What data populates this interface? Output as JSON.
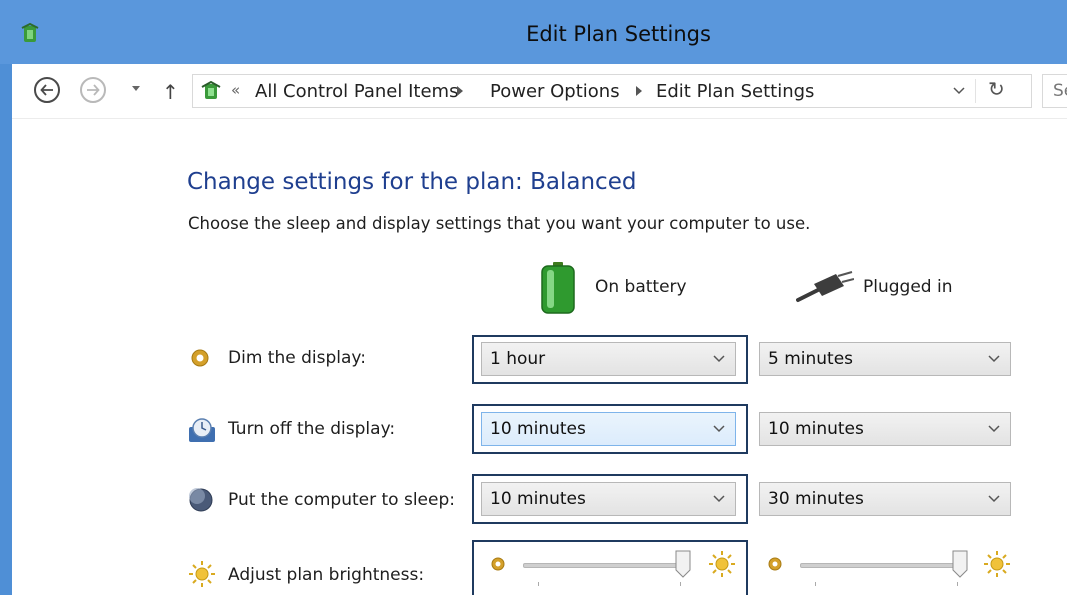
{
  "window": {
    "title": "Edit Plan Settings"
  },
  "address_bar": {
    "overflow": "«",
    "crumbs": [
      "All Control Panel Items",
      "Power Options",
      "Edit Plan Settings"
    ],
    "search_placeholder": "Se"
  },
  "page": {
    "heading": "Change settings for the plan: Balanced",
    "description": "Choose the sleep and display settings that you want your computer to use."
  },
  "columns": {
    "battery": "On battery",
    "plugged": "Plugged in"
  },
  "settings": {
    "dim": {
      "label": "Dim the display:",
      "battery": "1 hour",
      "plugged": "5 minutes",
      "icon": "dim-display-icon"
    },
    "display_off": {
      "label": "Turn off the display:",
      "battery": "10 minutes",
      "plugged": "10 minutes",
      "icon": "display-clock-icon"
    },
    "sleep": {
      "label": "Put the computer to sleep:",
      "battery": "10 minutes",
      "plugged": "30 minutes",
      "icon": "moon-sleep-icon"
    },
    "brightness": {
      "label": "Adjust plan brightness:",
      "battery_level": 1.0,
      "plugged_level": 1.0,
      "icon": "sun-brightness-icon"
    }
  },
  "colors": {
    "titlebar": "#5a97dc",
    "heading": "#1f3f8f",
    "focus_border": "#1f3a5f"
  }
}
